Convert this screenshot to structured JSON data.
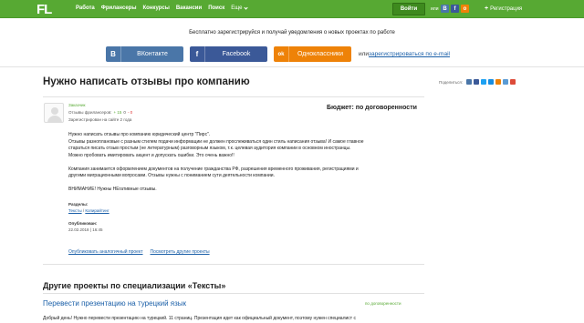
{
  "header": {
    "logo": "FL",
    "nav": [
      "Работа",
      "Фрилансеры",
      "Конкурсы",
      "Вакансии",
      "Поиск"
    ],
    "more": "Еще",
    "login": "Войти",
    "or": "или",
    "social_mini": [
      "B",
      "f",
      "o"
    ],
    "register": "Регистрация"
  },
  "promo": {
    "text": "Бесплатно зарегистрируйся и получай уведомления о новых проектах по работе",
    "buttons": [
      {
        "icon": "B",
        "label": "ВКонтакте",
        "color": "#4a76a8"
      },
      {
        "icon": "f",
        "label": "Facebook",
        "color": "#3b5998"
      },
      {
        "icon": "ok",
        "label": "Одноклассники",
        "color": "#ee8208"
      }
    ],
    "or": "или",
    "email": "зарегистрироваться по e-mail"
  },
  "project": {
    "title": "Нужно написать отзывы про компанию",
    "share_label": "Поделиться:",
    "share_colors": [
      "#4a76a8",
      "#3b5998",
      "#1da1f2",
      "#168de2",
      "#ee8208",
      "#5a9bd4",
      "#dd4b39"
    ],
    "client_role": "Заказчик",
    "rating_label": "Отзывы фрилансеров:",
    "rating_pos": "+ 15",
    "rating_neu": "0",
    "rating_neg": "- 0",
    "registered": "Зарегистрирован на сайте 2 года",
    "budget": "Бюджет: по договоренности",
    "description": [
      "Нужно написать отзывы про компанию юридический центр \"Пирс\".",
      "Отзывы разноплановые с разным стилем подачи информации не должен прослеживаться один стиль написания отзыва! И самое главное",
      "стараться писать отзыв простым (не литературным) разговорным языком, т.к. целевая аудитория компании в основном иностранцы.",
      "Можно пробовать имитировать акцент и допускать ошибки. Это очень важно!!",
      "Компания занимается оформлением документов на получение гражданства РФ, разрешения временного проживания, регистрациями и",
      "другими миграционными вопросами. Отзывы нужны с пониманием сути деятельности компании.",
      "ВНИМАНИЕ! Нужны НЕгативные отзывы."
    ],
    "sections_label": "Разделы:",
    "section_1": "Тексты",
    "section_sep": " / ",
    "section_2": "Копирайтинг",
    "published_label": "Опубликован:",
    "published": "22.02.2018 | 16:45",
    "action_1": "Опубликовать аналогичный проект",
    "action_2": "Посмотреть другие проекты"
  },
  "other": {
    "title": "Другие проекты по специализации «Тексты»",
    "item_title": "Перевести презентацию на турецкий язык",
    "item_budget": "по договоренности",
    "item_desc": "Добрый день! Нужно перевести презентацию на турецкий. 11 страниц. Презентация идет как официальный документ, поэтому нужен специалист с"
  }
}
